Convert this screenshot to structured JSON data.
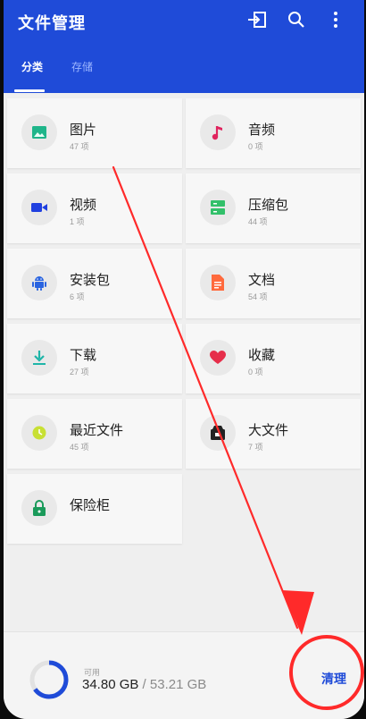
{
  "app": {
    "title": "文件管理",
    "tabs": [
      {
        "label": "分类",
        "active": true
      },
      {
        "label": "存储",
        "active": false
      }
    ]
  },
  "categories": [
    {
      "name": "图片",
      "count": "47 项",
      "icon": "image-icon",
      "color": "#1fb58a"
    },
    {
      "name": "音频",
      "count": "0 项",
      "icon": "music-note-icon",
      "color": "#e0245e"
    },
    {
      "name": "视频",
      "count": "1 项",
      "icon": "video-icon",
      "color": "#2040e0"
    },
    {
      "name": "压缩包",
      "count": "44 项",
      "icon": "archive-icon",
      "color": "#32c06a"
    },
    {
      "name": "安装包",
      "count": "6 项",
      "icon": "android-icon",
      "color": "#2a64e0"
    },
    {
      "name": "文档",
      "count": "54 项",
      "icon": "document-icon",
      "color": "#ff6a3d"
    },
    {
      "name": "下载",
      "count": "27 项",
      "icon": "download-icon",
      "color": "#1fb5a8"
    },
    {
      "name": "收藏",
      "count": "0 项",
      "icon": "heart-icon",
      "color": "#e62e4a"
    },
    {
      "name": "最近文件",
      "count": "45 项",
      "icon": "recent-icon",
      "color": "#c8e034"
    },
    {
      "name": "大文件",
      "count": "7 项",
      "icon": "large-file-icon",
      "color": "#222222"
    },
    {
      "name": "保险柜",
      "count": "",
      "icon": "lock-icon",
      "color": "#1a9a5a"
    }
  ],
  "storage": {
    "label": "可用",
    "used": "34.80 GB",
    "separator": " / ",
    "total": "53.21 GB",
    "available_fraction": 0.654,
    "clean_label": "清理"
  },
  "colors": {
    "brand": "#1f4bd8",
    "annotation": "#ff2a2a"
  }
}
